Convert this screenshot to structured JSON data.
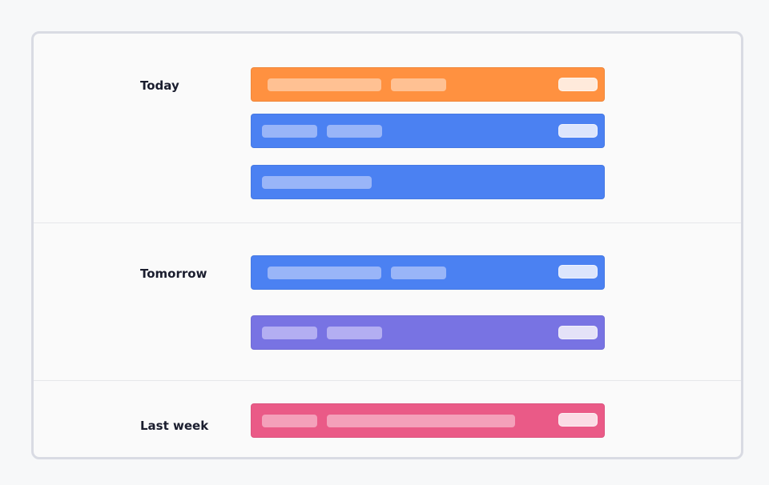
{
  "sections": [
    {
      "label": "Today"
    },
    {
      "label": "Tomorrow"
    },
    {
      "label": "Last week"
    }
  ],
  "colors": {
    "orange": "#ff9140",
    "blue": "#4b81f2",
    "purple": "#7873e3",
    "pink": "#ea5a87"
  },
  "rows": [
    {
      "section": "Today",
      "color": "orange"
    },
    {
      "section": "Today",
      "color": "blue"
    },
    {
      "section": "Today",
      "color": "blue"
    },
    {
      "section": "Tomorrow",
      "color": "blue"
    },
    {
      "section": "Tomorrow",
      "color": "purple"
    },
    {
      "section": "Last week",
      "color": "pink"
    }
  ]
}
